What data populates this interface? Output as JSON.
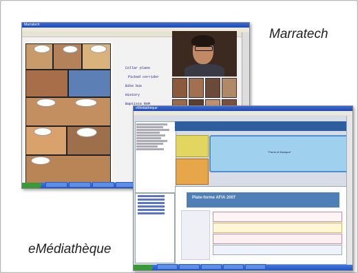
{
  "labels": {
    "marratech": "Marratech",
    "emediatheque": "eMédiathèque"
  },
  "marratech_window": {
    "title": "Marratech",
    "notes": [
      "Collar plans",
      "Picked corridor",
      "Bike bus",
      "History",
      "Baptiste RAM"
    ]
  },
  "emediatheque_window": {
    "title": "eMédiathèque",
    "blue_panel_text": "\"Pardo et Musique\"",
    "banner_text": "Plate-forme AFIA 2007"
  },
  "colors": {
    "accent_blue": "#2f5e9e",
    "banner": "#4f7fb7",
    "yellow": "#e2d560"
  }
}
